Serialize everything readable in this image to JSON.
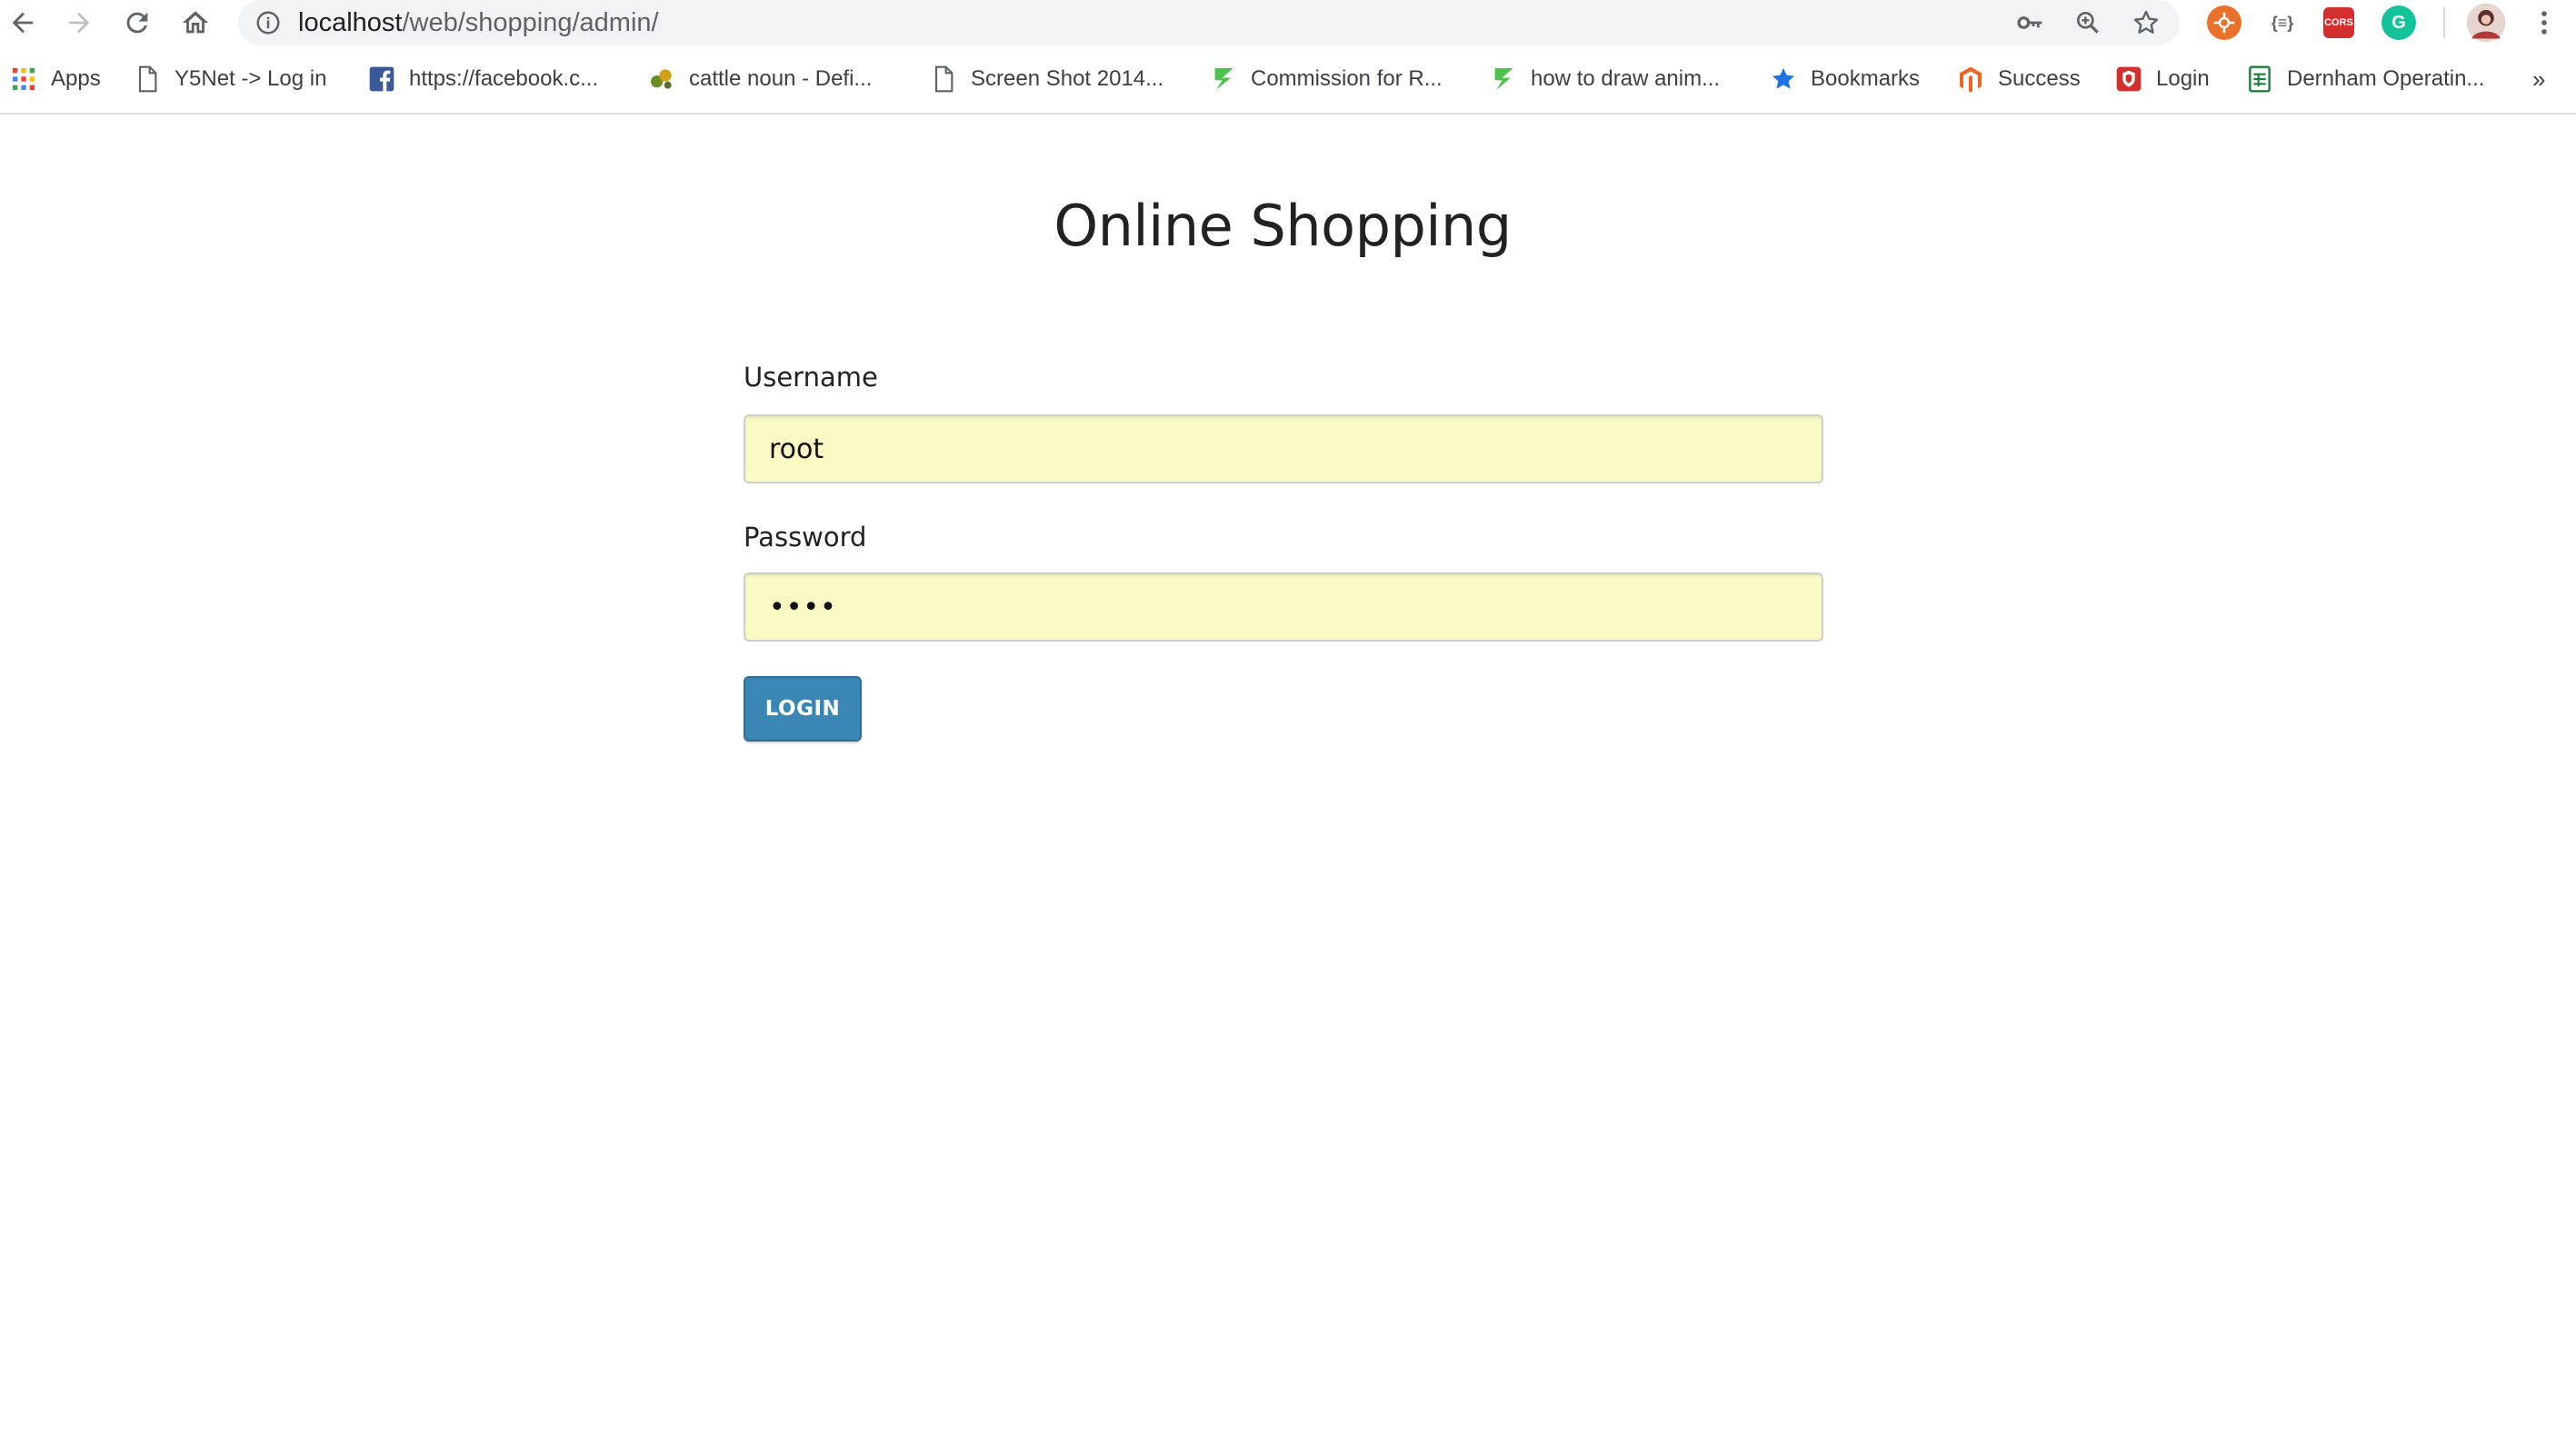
{
  "browser": {
    "url_host": "localhost",
    "url_path": "/web/shopping/admin/",
    "icons": {
      "back": "back-arrow-icon",
      "forward": "forward-arrow-icon",
      "reload": "reload-icon",
      "home": "home-icon",
      "site_info": "info-icon",
      "key": "key-icon",
      "zoom": "zoom-icon",
      "bookmark_star": "star-icon",
      "menu": "kebab-menu-icon"
    },
    "extensions": [
      {
        "name": "orange-extension-icon",
        "color": "#e8712b"
      },
      {
        "name": "json-extension-icon",
        "label": "{≡}",
        "color": "#5f6368"
      },
      {
        "name": "cors-extension-icon",
        "label": "CORS",
        "color": "#d32f2f"
      },
      {
        "name": "grammarly-extension-icon",
        "label": "G",
        "color": "#15c39a"
      }
    ],
    "bookmarks": [
      {
        "label": "Apps",
        "icon": "apps-grid-icon"
      },
      {
        "label": "Y5Net -> Log in",
        "icon": "page-icon"
      },
      {
        "label": "https://facebook.c...",
        "icon": "facebook-icon"
      },
      {
        "label": "cattle noun - Defi...",
        "icon": "dictionary-icon"
      },
      {
        "label": "Screen Shot 2014...",
        "icon": "page-icon"
      },
      {
        "label": "Commission for R...",
        "icon": "green-z-icon"
      },
      {
        "label": "how to draw anim...",
        "icon": "green-z-icon"
      },
      {
        "label": "Bookmarks",
        "icon": "star-icon"
      },
      {
        "label": "Success",
        "icon": "magento-icon"
      },
      {
        "label": "Login",
        "icon": "shield-icon"
      },
      {
        "label": "Dernham Operatin...",
        "icon": "sheets-icon"
      }
    ],
    "overflow": "»"
  },
  "page": {
    "title": "Online Shopping",
    "username_label": "Username",
    "username_value": "root",
    "password_label": "Password",
    "password_value": "••••",
    "login_label": "LOGIN"
  },
  "colors": {
    "autofill_bg": "#fafac4",
    "button_bg": "#3a87b6"
  }
}
